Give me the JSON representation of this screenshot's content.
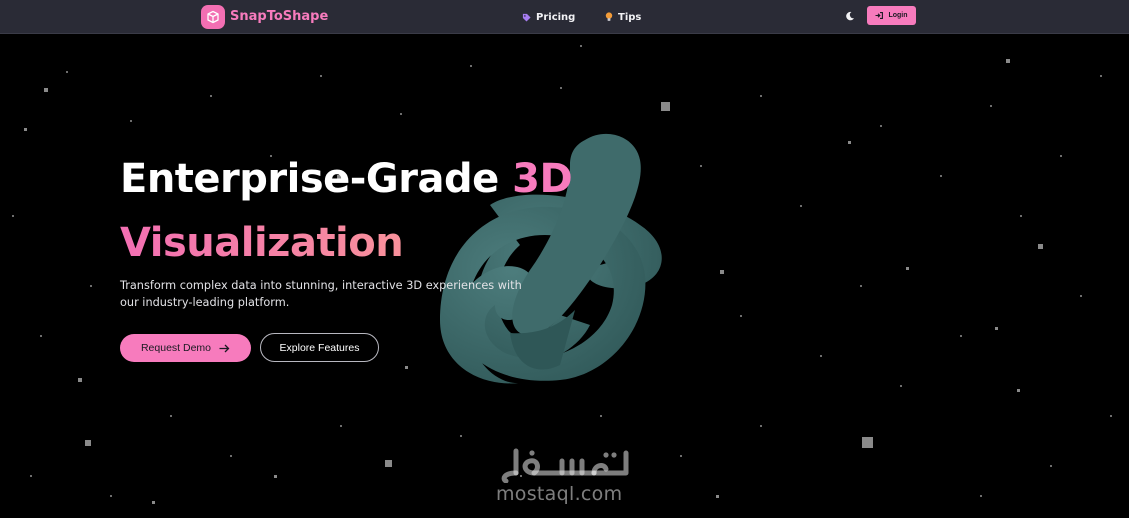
{
  "brand": {
    "name": "SnapToShape",
    "logo_icon": "cube-icon",
    "color": "#f77bbd"
  },
  "nav": {
    "items": [
      {
        "label": "Pricing",
        "icon": "tag-icon",
        "icon_color": "#a77df2"
      },
      {
        "label": "Tips",
        "icon": "lightbulb-icon",
        "icon_color": "#f29b38"
      }
    ],
    "theme_toggle_icon": "moon-icon",
    "login": {
      "label": "Login",
      "icon": "sign-in-icon"
    }
  },
  "hero": {
    "title_part1": "Enterprise-Grade ",
    "title_accent": "3D",
    "title_line2": "Visualization",
    "subtitle": "Transform complex data into stunning, interactive 3D experiences with our industry-leading platform.",
    "primary_cta": "Request Demo",
    "secondary_cta": "Explore Features",
    "model_color": "#3f6b6b"
  },
  "watermark": {
    "arabic": "مستقل",
    "latin": "mostaql.com"
  },
  "colors": {
    "navbar_bg": "#2a2b36",
    "accent": "#f77bbd",
    "gradient_end": "#fba58c",
    "background": "#000000"
  }
}
